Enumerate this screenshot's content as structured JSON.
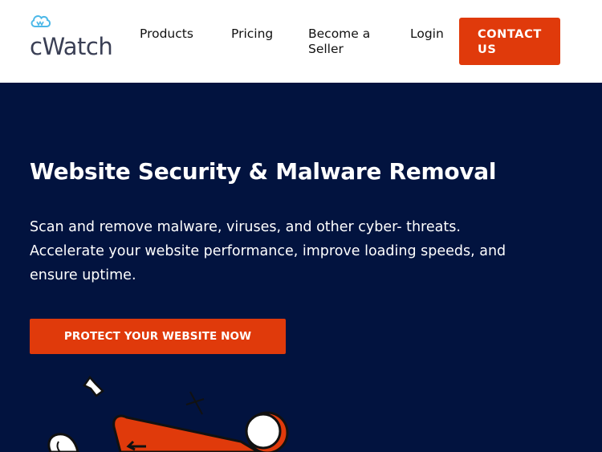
{
  "header": {
    "logo_text": "cWatch",
    "logo_icon": "cloud-icon",
    "nav": {
      "products": "Products",
      "pricing": "Pricing",
      "seller": "Become a Seller",
      "login": "Login"
    },
    "contact_label": "CONTACT US"
  },
  "hero": {
    "title": "Website Security & Malware Removal",
    "description": "Scan and remove malware, viruses, and other cyber- threats. Accelerate your website performance, improve loading speeds, and ensure uptime.",
    "cta_label": "PROTECT YOUR WEBSITE NOW"
  },
  "colors": {
    "background": "#02133f",
    "accent": "#e03a0b",
    "header_bg": "#ffffff",
    "logo_cloud": "#4cb8e8"
  },
  "illustration_icons": [
    "sparkle-icon",
    "cross-icon",
    "shield-illustration",
    "bubble-illustration",
    "circle-illustration"
  ]
}
